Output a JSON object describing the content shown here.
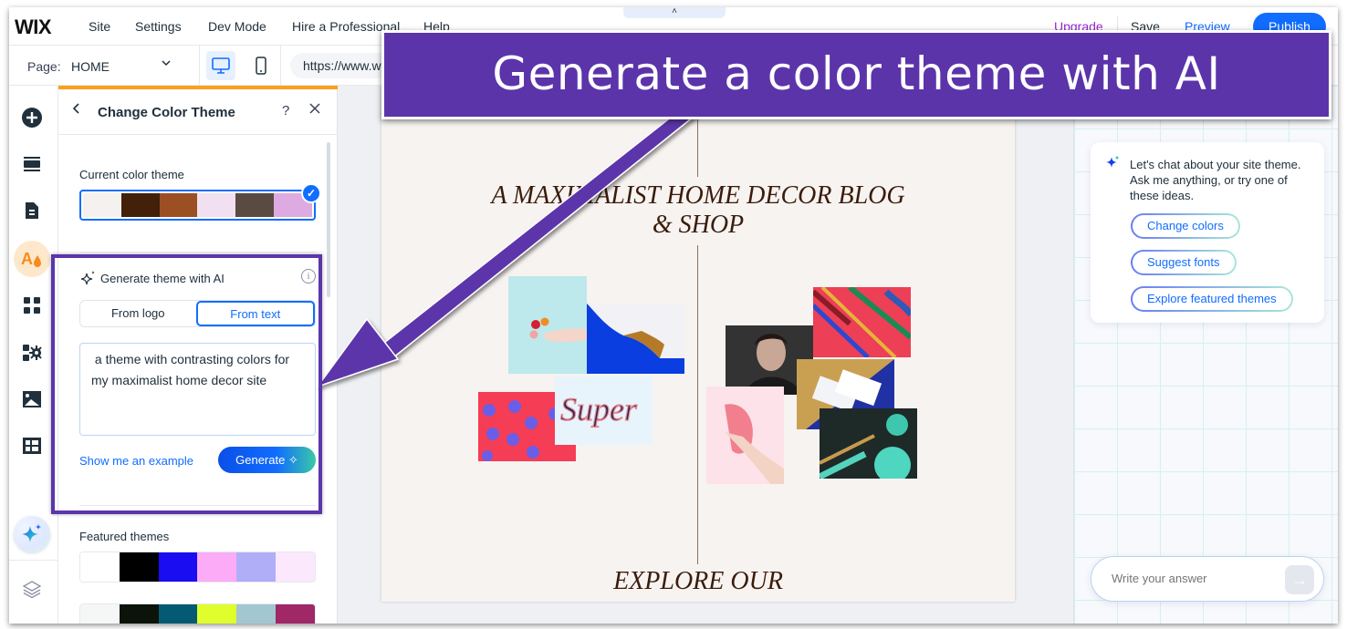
{
  "topbar": {
    "logo": "WIX",
    "menu": [
      "Site",
      "Settings",
      "Dev Mode",
      "Hire a Professional",
      "Help"
    ],
    "upgrade": "Upgrade",
    "save": "Save",
    "preview": "Preview",
    "publish": "Publish",
    "collapse_glyph": "˄"
  },
  "pagebar": {
    "page_label": "Page:",
    "page_value": "HOME",
    "url": "https://www.w"
  },
  "panel": {
    "title": "Change Color Theme",
    "current_label": "Current color theme",
    "current_colors": [
      "#f5f1ee",
      "#42200a",
      "#9c4f22",
      "#f0e0f2",
      "#594a42",
      "#ddaae1"
    ],
    "ai": {
      "title": "Generate theme with AI",
      "tabs": [
        "From logo",
        "From text"
      ],
      "active_tab": "From text",
      "prompt_value": " a theme with contrasting colors for my maximalist home decor site",
      "example_link": "Show me an example",
      "generate": "Generate"
    },
    "featured_label": "Featured themes",
    "featured": [
      [
        "#ffffff",
        "#000000",
        "#1a0df2",
        "#fcabf6",
        "#b0aef7",
        "#fce8fd"
      ],
      [
        "#f5f7f6",
        "#0c1409",
        "#055a73",
        "#dffe2b",
        "#a3c6d3",
        "#a02768"
      ]
    ]
  },
  "site": {
    "title": "A MAXIMALIST HOME DECOR BLOG & SHOP",
    "subtitle": "EXPLORE OUR"
  },
  "chat": {
    "message": "Let's chat about your site theme. Ask me anything, or try one of these ideas.",
    "chips": [
      "Change colors",
      "Suggest fonts",
      "Explore featured themes"
    ],
    "input_placeholder": "Write your answer"
  },
  "annotation": {
    "banner": "Generate a color theme with AI",
    "color": "#5b34aa"
  }
}
